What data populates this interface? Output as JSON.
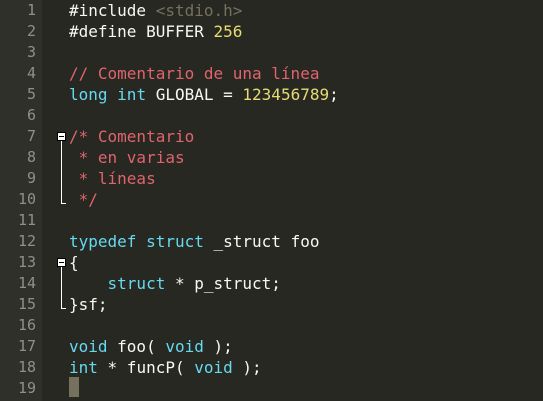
{
  "line_numbers": [
    "1",
    "2",
    "3",
    "4",
    "5",
    "6",
    "7",
    "8",
    "9",
    "10",
    "11",
    "12",
    "13",
    "14",
    "15",
    "16",
    "17",
    "18",
    "19"
  ],
  "code_lines": [
    {
      "tokens": [
        {
          "t": "#include ",
          "c": "pp"
        },
        {
          "t": "<stdio.h>",
          "c": "incl"
        }
      ]
    },
    {
      "tokens": [
        {
          "t": "#define BUFFER ",
          "c": "pp"
        },
        {
          "t": "256",
          "c": "num"
        }
      ]
    },
    {
      "tokens": []
    },
    {
      "tokens": [
        {
          "t": "// Comentario de una línea",
          "c": "comment"
        }
      ]
    },
    {
      "tokens": [
        {
          "t": "long",
          "c": "kw-type"
        },
        {
          "t": " ",
          "c": ""
        },
        {
          "t": "int",
          "c": "kw-type"
        },
        {
          "t": " GLOBAL = ",
          "c": ""
        },
        {
          "t": "123456789",
          "c": "num"
        },
        {
          "t": ";",
          "c": ""
        }
      ]
    },
    {
      "tokens": []
    },
    {
      "tokens": [
        {
          "t": "/* Comentario",
          "c": "comment"
        }
      ]
    },
    {
      "tokens": [
        {
          "t": " * en varias",
          "c": "comment"
        }
      ]
    },
    {
      "tokens": [
        {
          "t": " * líneas",
          "c": "comment"
        }
      ]
    },
    {
      "tokens": [
        {
          "t": " */",
          "c": "comment"
        }
      ]
    },
    {
      "tokens": []
    },
    {
      "tokens": [
        {
          "t": "typedef",
          "c": "kw-type"
        },
        {
          "t": " ",
          "c": ""
        },
        {
          "t": "struct",
          "c": "kw-type"
        },
        {
          "t": " _struct foo",
          "c": ""
        }
      ]
    },
    {
      "tokens": [
        {
          "t": "{",
          "c": ""
        }
      ]
    },
    {
      "tokens": [
        {
          "t": "    ",
          "c": ""
        },
        {
          "t": "struct",
          "c": "kw-type"
        },
        {
          "t": " * p_struct;",
          "c": ""
        }
      ]
    },
    {
      "tokens": [
        {
          "t": "}sf;",
          "c": ""
        }
      ]
    },
    {
      "tokens": []
    },
    {
      "tokens": [
        {
          "t": "void",
          "c": "kw-type"
        },
        {
          "t": " foo( ",
          "c": ""
        },
        {
          "t": "void",
          "c": "kw-type"
        },
        {
          "t": " );",
          "c": ""
        }
      ]
    },
    {
      "tokens": [
        {
          "t": "int",
          "c": "kw-type"
        },
        {
          "t": " * funcP( ",
          "c": ""
        },
        {
          "t": "void",
          "c": "kw-type"
        },
        {
          "t": " );",
          "c": ""
        }
      ]
    },
    {
      "tokens": []
    }
  ],
  "folds": [
    {
      "start": 7,
      "end": 10
    },
    {
      "start": 13,
      "end": 15
    }
  ],
  "colors": {
    "background": "#272822",
    "gutter": "#2f302a",
    "type_keyword": "#66d9ef",
    "number": "#e6db74",
    "comment": "#e0646e",
    "include_path": "#75715e"
  }
}
